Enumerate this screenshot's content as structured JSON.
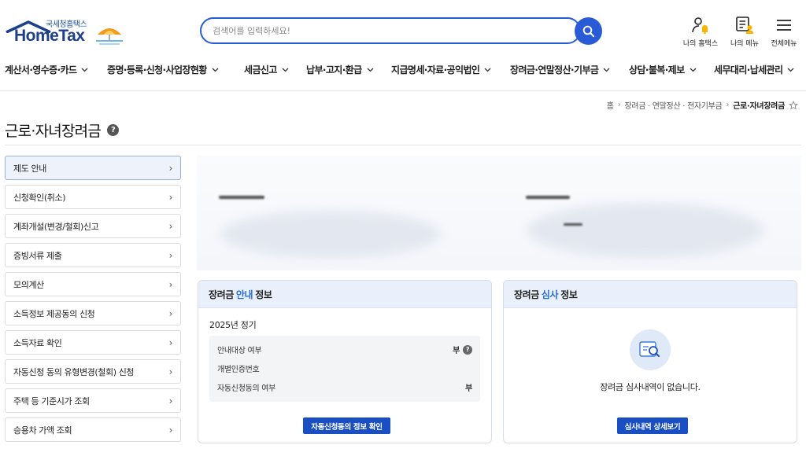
{
  "header": {
    "logo_sub": "국세청홈택스",
    "logo_main": "HomeTax",
    "search_placeholder": "검색어를 입력하세요!",
    "utils": [
      {
        "label": "나의 홈택스",
        "icon": "user-bell-icon"
      },
      {
        "label": "나의 메뉴",
        "icon": "my-menu-icon"
      },
      {
        "label": "전체메뉴",
        "icon": "hamburger-icon"
      }
    ]
  },
  "gnb": [
    {
      "label": "계산서·영수증·카드"
    },
    {
      "label": "증명·등록·신청·사업장현황"
    },
    {
      "label": "세금신고"
    },
    {
      "label": "납부·고지·환급"
    },
    {
      "label": "지급명세·자료·공익법인"
    },
    {
      "label": "장려금·연말정산·기부금"
    },
    {
      "label": "상담·불복·제보"
    },
    {
      "label": "세무대리·납세관리"
    }
  ],
  "breadcrumb": {
    "home": "홈",
    "level1": "장려금 · 연말정산 · 전자기부금",
    "current": "근로·자녀장려금"
  },
  "page_title": "근로·자녀장려금",
  "side_menu": [
    {
      "label": "제도 안내"
    },
    {
      "label": "신청확인(취소)"
    },
    {
      "label": "계좌개설(변경/철회)신고"
    },
    {
      "label": "증빙서류 제출"
    },
    {
      "label": "모의계산"
    },
    {
      "label": "소득정보 제공동의 신청"
    },
    {
      "label": "소득자료 확인"
    },
    {
      "label": "자동신청 동의 유형변경(철회) 신청"
    },
    {
      "label": "주택 등 기준시가 조회"
    },
    {
      "label": "승용차 가액 조회"
    }
  ],
  "guide_card": {
    "title_pre": "장려금",
    "title_accent": "안내",
    "title_post": "정보",
    "year": "2025년 정기",
    "rows": [
      {
        "label": "안내대상 여부",
        "value": "부"
      },
      {
        "label": "개별인증번호",
        "value": ""
      },
      {
        "label": "자동신청동의 여부",
        "value": "부"
      }
    ],
    "button": "자동신청동의 정보 확인"
  },
  "review_card": {
    "title_pre": "장려금",
    "title_accent": "심사",
    "title_post": "정보",
    "empty_text": "장려금 심사내역이 없습니다.",
    "button": "심사내역 상세보기"
  },
  "colors": {
    "brand": "#1d3f8c",
    "accent": "#2a5bd7",
    "button": "#1a4fc4",
    "card_head": "#e9f0fb"
  }
}
